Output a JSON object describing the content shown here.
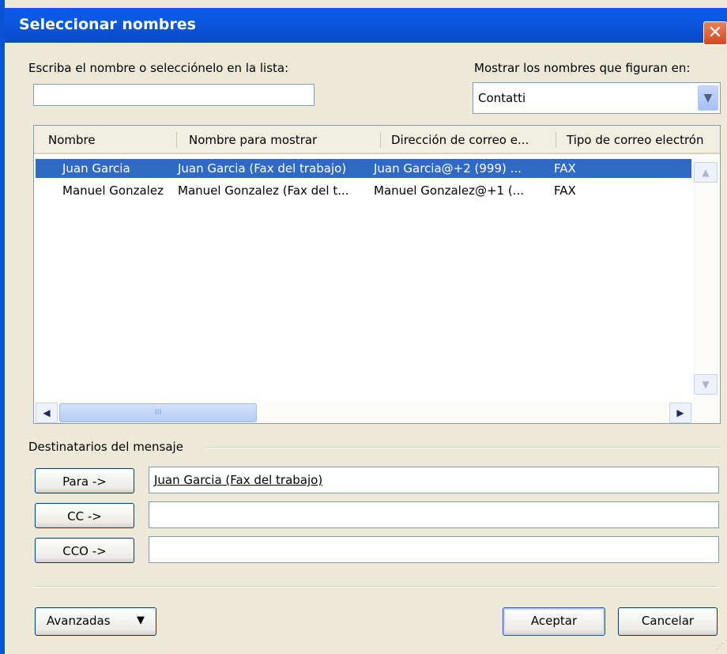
{
  "window": {
    "title": "Seleccionar nombres",
    "close_symbol": "✕"
  },
  "search": {
    "label": "Escriba el nombre o selecciónelo en la lista:",
    "value": ""
  },
  "address_book": {
    "label": "Mostrar los nombres que figuran en:",
    "selected": "Contatti"
  },
  "list": {
    "columns": [
      "Nombre",
      "Nombre para mostrar",
      "Dirección de correo e...",
      "Tipo de correo electrón"
    ],
    "rows": [
      {
        "name": "Juan Garcia",
        "display": "Juan Garcia (Fax del trabajo)",
        "address": "Juan Garcia@+2 (999) ...",
        "type": "FAX",
        "selected": true
      },
      {
        "name": "Manuel Gonzalez",
        "display": "Manuel Gonzalez (Fax del t...",
        "address": "Manuel Gonzalez@+1 (...",
        "type": "FAX",
        "selected": false
      }
    ],
    "scroll_thumb_grip": "III"
  },
  "recipients": {
    "label": "Destinatarios del mensaje",
    "to_button": "Para ->",
    "to_value": "Juan Garcia (Fax del trabajo)",
    "cc_button": "CC ->",
    "cc_value": "",
    "bcc_button": "CCO ->",
    "bcc_value": ""
  },
  "footer": {
    "advanced": "Avanzadas",
    "ok": "Aceptar",
    "cancel": "Cancelar"
  },
  "colors": {
    "title_bar": "#0a56de",
    "selection": "#316ac5",
    "face": "#ece9d8"
  }
}
